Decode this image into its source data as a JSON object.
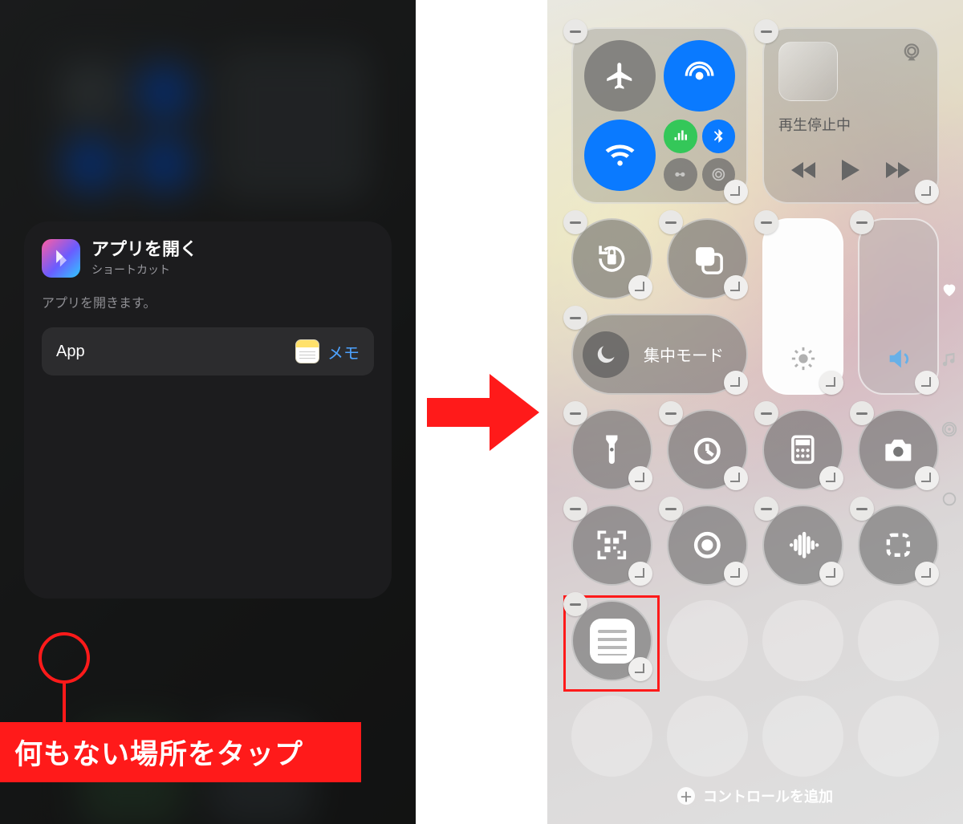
{
  "left": {
    "card": {
      "title": "アプリを開く",
      "subtitle": "ショートカット",
      "description": "アプリを開きます。",
      "app_label": "App",
      "app_value": "メモ"
    },
    "annotation": "何もない場所をタップ"
  },
  "right": {
    "media": {
      "status": "再生停止中"
    },
    "focus": {
      "label": "集中モード"
    },
    "add_control": "コントロールを追加",
    "icons": {
      "airplane": "airplane-icon",
      "airdrop": "airdrop-icon",
      "wifi": "wifi-icon",
      "cellular": "cellular-icon",
      "bluetooth": "bluetooth-icon",
      "hotspot": "hotspot-icon",
      "satellite": "satellite-icon",
      "airplay": "airplay-icon",
      "rewind": "rewind-icon",
      "play": "play-icon",
      "forward": "forward-icon",
      "rotation_lock": "rotation-lock-icon",
      "screen_mirror": "screen-mirroring-icon",
      "moon": "moon-icon",
      "brightness": "brightness-icon",
      "volume": "volume-icon",
      "flashlight": "flashlight-icon",
      "timer": "timer-icon",
      "calculator": "calculator-icon",
      "camera": "camera-icon",
      "qr": "qr-icon",
      "record": "record-icon",
      "sound": "sound-recognition-icon",
      "dashed": "dashed-square-icon",
      "notes": "notes-icon",
      "heart": "heart-icon",
      "music": "music-icon",
      "broadcast": "broadcast-icon",
      "circle": "circle-icon"
    }
  }
}
